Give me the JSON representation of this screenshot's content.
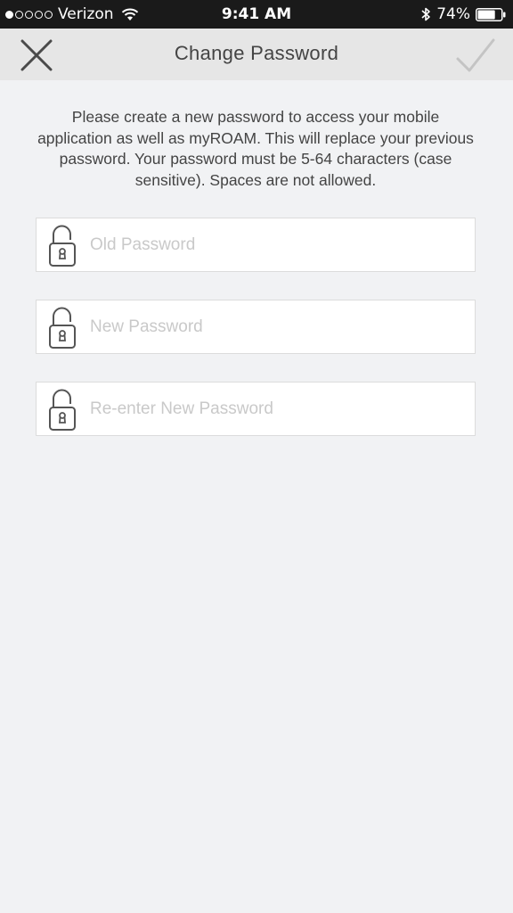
{
  "status_bar": {
    "signal_dots_filled": 1,
    "signal_dots_total": 5,
    "carrier": "Verizon",
    "wifi_icon": "wifi-icon",
    "time": "9:41 AM",
    "bluetooth_icon": "bluetooth-icon",
    "battery_percent": "74%",
    "battery_level": 0.74
  },
  "nav": {
    "title": "Change Password",
    "close_icon": "close-icon",
    "confirm_icon": "checkmark-icon"
  },
  "instructions": "Please create a new password to access your mobile application as well as myROAM. This will replace your previous password. Your password must be 5-64 characters (case sensitive). Spaces are not allowed.",
  "fields": {
    "old_password": {
      "placeholder": "Old Password",
      "value": "",
      "icon": "lock-icon"
    },
    "new_password": {
      "placeholder": "New Password",
      "value": "",
      "icon": "lock-icon"
    },
    "reenter_password": {
      "placeholder": "Re-enter New Password",
      "value": "",
      "icon": "lock-icon"
    }
  },
  "colors": {
    "background": "#f1f2f4",
    "nav_background": "#e6e6e6",
    "status_bar": "#1a1a1a",
    "text": "#444444",
    "placeholder": "#c9c9c9"
  }
}
